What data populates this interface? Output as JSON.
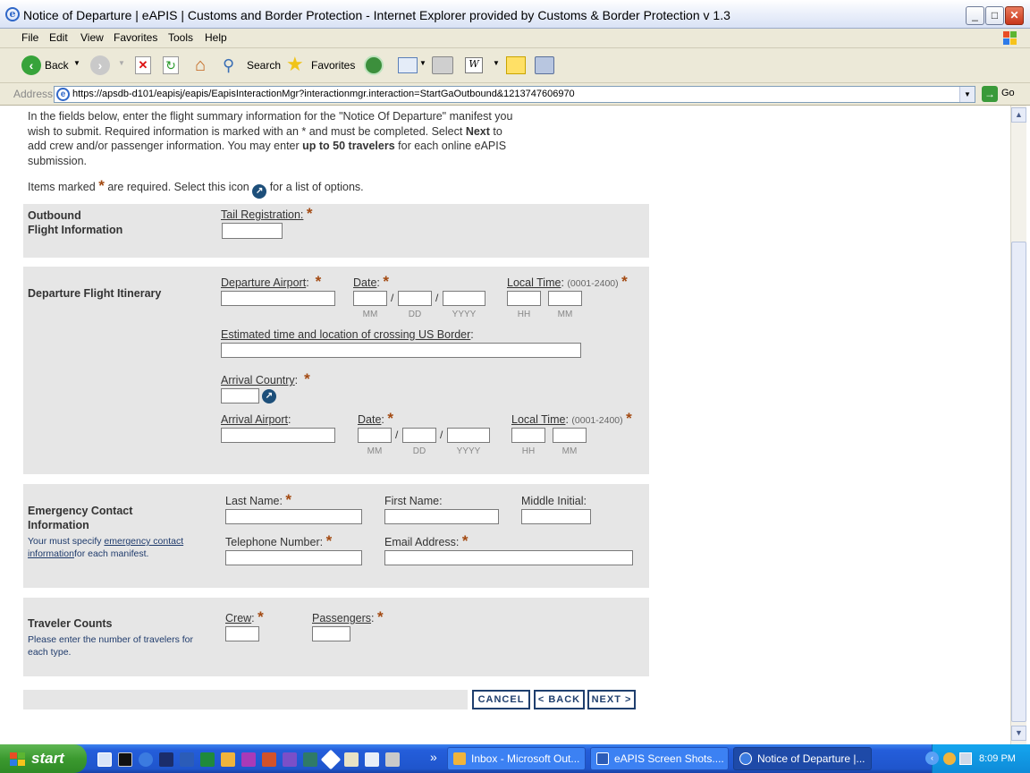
{
  "window": {
    "title": "Notice of Departure | eAPIS | Customs and Border Protection - Internet Explorer provided by Customs & Border Protection v 1.3",
    "min": "_",
    "max": "□",
    "close": "✕"
  },
  "menu": [
    "File",
    "Edit",
    "View",
    "Favorites",
    "Tools",
    "Help"
  ],
  "toolbar": {
    "back": "Back",
    "search": "Search",
    "favorites": "Favorites"
  },
  "address": {
    "label": "Address",
    "url": "https://apsdb-d101/eapisj/eapis/EapisInteractionMgr?interactionmgr.interaction=StartGaOutbound&1213747606970",
    "go": "Go"
  },
  "intro": {
    "line1": "In the fields below, enter the flight summary information for the \"Notice Of Departure\" manifest you",
    "line2": "wish to submit. Required information is marked with an * and must be completed. Select",
    "next_word": "Next",
    "line2_end": "to",
    "line3": "add crew and/or passenger information. You may enter",
    "up_to": "up to 50 travelers",
    "line3_end": "for each online eAPIS",
    "line4": "submission.",
    "items_marked": "Items marked",
    "required_text": "are required. Select this icon",
    "options_text": "for a list of options."
  },
  "star": "*",
  "outbound": {
    "title1": "Outbound",
    "title2": "Flight Information",
    "tail_label": "Tail Registration:"
  },
  "departure": {
    "title": "Departure Flight Itinerary",
    "dep_airport": "Departure Airport",
    "date": "Date",
    "local_time": "Local Time",
    "time_hint": "(0001-2400)",
    "mm": "MM",
    "dd": "DD",
    "yyyy": "YYYY",
    "hh": "HH",
    "min": "MM",
    "slash": "/",
    "crossing": "Estimated time and location of crossing US Border",
    "arrival_country": "Arrival Country",
    "arrival_airport": "Arrival Airport",
    "colon": ":"
  },
  "emergency": {
    "title1": "Emergency Contact",
    "title2": "Information",
    "note1_a": "Your must specify",
    "note1_link": "emergency contact",
    "note2_link": "information",
    "note2_b": "for each manifest.",
    "last_name": "Last Name:",
    "first_name": "First Name:",
    "middle_initial": "Middle Initial:",
    "telephone": "Telephone Number:",
    "email": "Email Address:"
  },
  "counts": {
    "title": "Traveler Counts",
    "note1": "Please enter the number of travelers for",
    "note2": "each type.",
    "crew": "Crew",
    "passengers": "Passengers"
  },
  "buttons": {
    "cancel": "CANCEL",
    "back": "< BACK",
    "next": "NEXT >"
  },
  "taskbar": {
    "start": "start",
    "tasks": [
      "Inbox - Microsoft Out...",
      "eAPIS Screen Shots....",
      "Notice of Departure |..."
    ],
    "clock": "8:09 PM",
    "more": "»"
  }
}
